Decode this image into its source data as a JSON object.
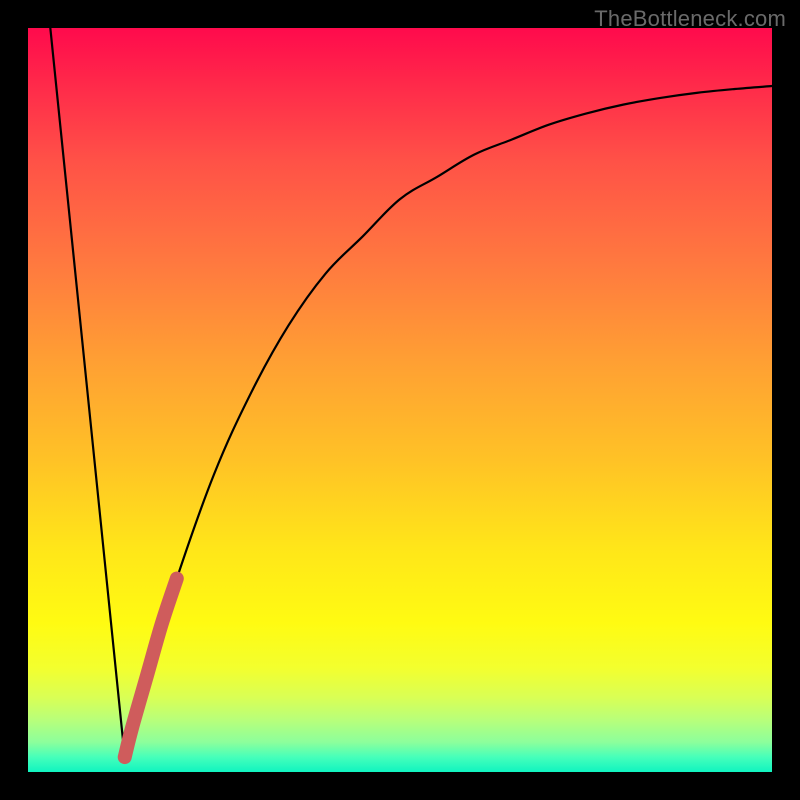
{
  "watermark": "TheBottleneck.com",
  "colors": {
    "background": "#000000",
    "gradient_top": "#ff0a4c",
    "gradient_bottom": "#10f4c0",
    "curve_stroke": "#000000",
    "highlight_stroke": "#cf5c5c"
  },
  "chart_data": {
    "type": "line",
    "title": "",
    "xlabel": "",
    "ylabel": "",
    "xlim": [
      0,
      100
    ],
    "ylim": [
      0,
      100
    ],
    "series": [
      {
        "name": "descending-line",
        "x": [
          3,
          13
        ],
        "y": [
          100,
          2
        ]
      },
      {
        "name": "ascending-curve",
        "x": [
          13,
          16,
          20,
          25,
          30,
          35,
          40,
          45,
          50,
          55,
          60,
          65,
          70,
          75,
          80,
          85,
          90,
          95,
          100
        ],
        "y": [
          2,
          13,
          26,
          40,
          51,
          60,
          67,
          72,
          77,
          80,
          83,
          85,
          87,
          88.5,
          89.7,
          90.6,
          91.3,
          91.8,
          92.2
        ]
      },
      {
        "name": "highlight-segment",
        "x": [
          13,
          14,
          16,
          18,
          20
        ],
        "y": [
          2,
          6,
          13,
          20,
          26
        ]
      }
    ]
  }
}
